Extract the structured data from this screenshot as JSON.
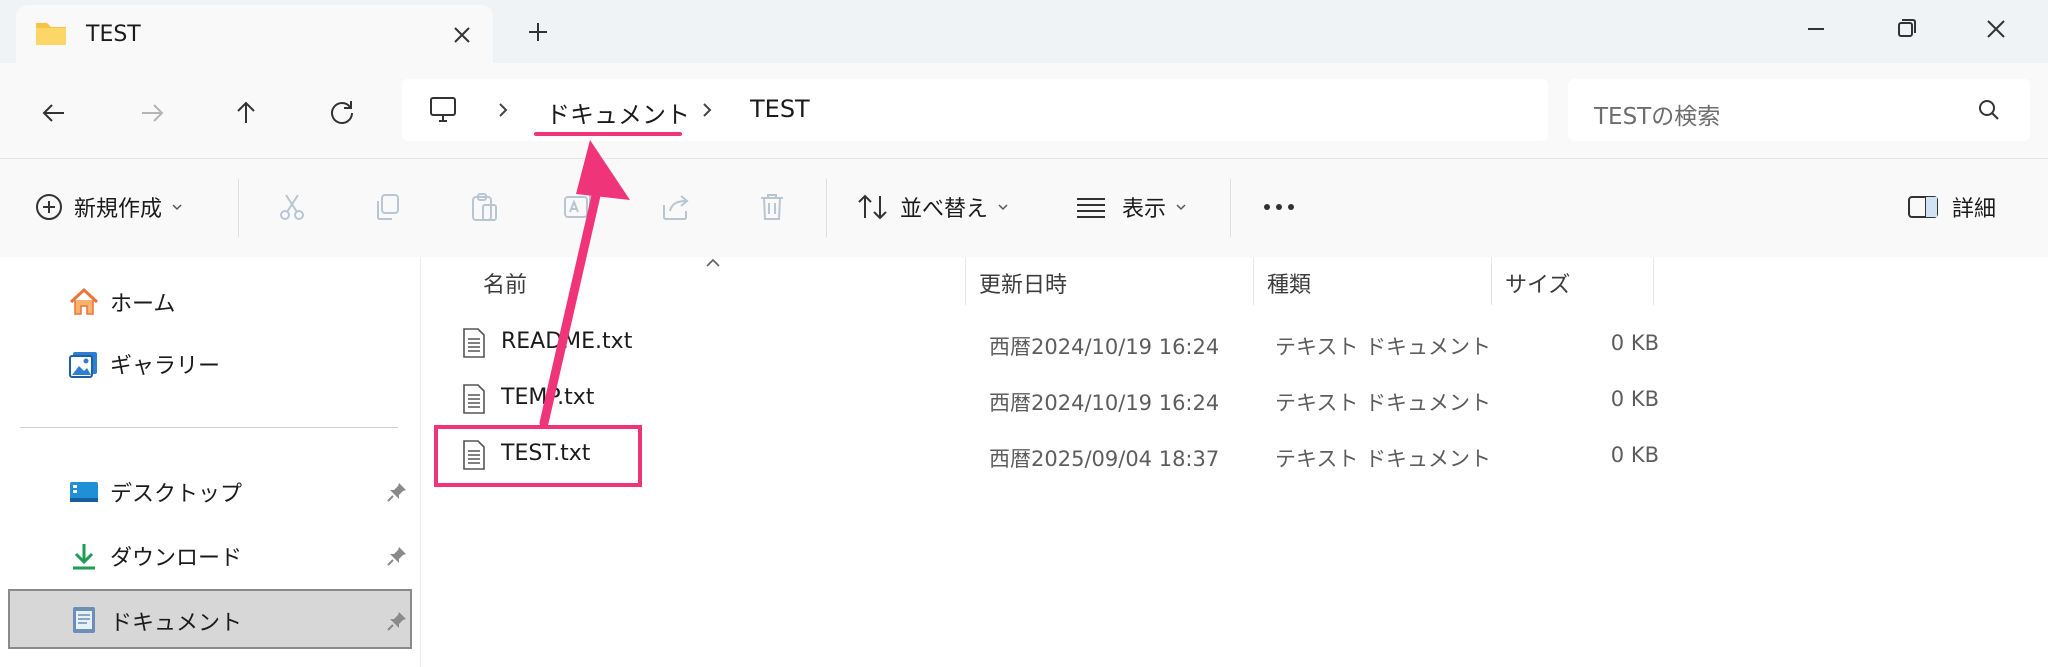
{
  "window": {
    "tab_title": "TEST",
    "icons": {
      "tab": "folder-icon",
      "close_tab": "close-icon",
      "new_tab": "plus-icon",
      "minimize": "minimize-icon",
      "restore": "restore-icon",
      "close_window": "close-icon"
    }
  },
  "navigation": {
    "buttons": [
      "back-arrow-icon",
      "forward-arrow-icon",
      "up-arrow-icon",
      "refresh-icon"
    ],
    "breadcrumb": {
      "root_icon": "computer-icon",
      "items": [
        "ドキュメント",
        "TEST"
      ]
    },
    "search_placeholder": "TESTの検索"
  },
  "commandbar": {
    "new_label": "新規作成",
    "sort_label": "並べ替え",
    "view_label": "表示",
    "details_label": "詳細",
    "icons": [
      "cut-icon",
      "copy-icon",
      "paste-icon",
      "rename-icon",
      "share-icon",
      "delete-icon",
      "more-icon",
      "details-pane-icon"
    ]
  },
  "sidebar": {
    "items": [
      {
        "label": "ホーム",
        "icon": "home-icon",
        "pinned": false
      },
      {
        "label": "ギャラリー",
        "icon": "gallery-icon",
        "pinned": false
      },
      {
        "label": "デスクトップ",
        "icon": "desktop-icon",
        "pinned": true
      },
      {
        "label": "ダウンロード",
        "icon": "download-icon",
        "pinned": true
      },
      {
        "label": "ドキュメント",
        "icon": "documents-icon",
        "pinned": true,
        "selected": true
      }
    ]
  },
  "filelist": {
    "columns": [
      "名前",
      "更新日時",
      "種類",
      "サイズ"
    ],
    "rows": [
      {
        "name": "README.txt",
        "modified": "西暦2024/10/19 16:24",
        "type": "テキスト ドキュメント",
        "size": "0 KB"
      },
      {
        "name": "TEMP.txt",
        "modified": "西暦2024/10/19 16:24",
        "type": "テキスト ドキュメント",
        "size": "0 KB"
      },
      {
        "name": "TEST.txt",
        "modified": "西暦2025/09/04 18:37",
        "type": "テキスト ドキュメント",
        "size": "0 KB"
      }
    ]
  },
  "annotation": {
    "color": "#f0347a"
  }
}
